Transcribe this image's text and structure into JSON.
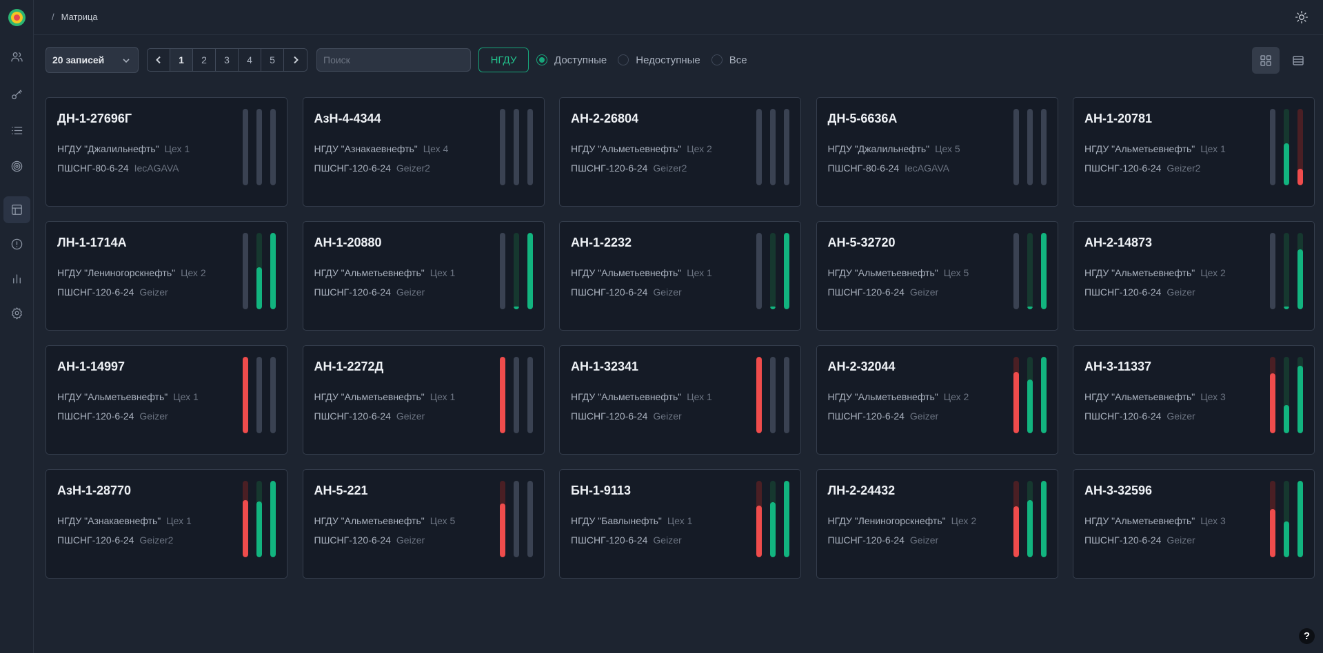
{
  "sidebar": {
    "items": [
      {
        "icon": "users-icon",
        "active": false
      },
      {
        "icon": "key-icon",
        "active": false
      },
      {
        "icon": "list-icon",
        "active": false
      },
      {
        "icon": "target-icon",
        "active": false
      },
      {
        "icon": "layout-icon",
        "active": true
      },
      {
        "icon": "alert-icon",
        "active": false
      },
      {
        "icon": "bar-chart-icon",
        "active": false
      },
      {
        "icon": "settings-icon",
        "active": false
      }
    ]
  },
  "header": {
    "breadcrumb_sep": "/",
    "breadcrumb": "Матрица"
  },
  "toolbar": {
    "page_size": "20 записей",
    "pages": [
      "1",
      "2",
      "3",
      "4",
      "5"
    ],
    "current_page": "1",
    "search_placeholder": "Поиск",
    "ngdu_label": "НГДУ",
    "filters": [
      {
        "label": "Доступные",
        "checked": true
      },
      {
        "label": "Недоступные",
        "checked": false
      },
      {
        "label": "Все",
        "checked": false
      }
    ]
  },
  "colors": {
    "accent": "#18a57a",
    "red": "#ef4c4c",
    "green": "#12b47f",
    "card_bg": "#151b26",
    "page_bg": "#1d2430"
  },
  "cards": [
    {
      "name": "ДН-1-27696Г",
      "ngdu": "НГДУ \"Джалильнефть\"",
      "shop": "Цех 1",
      "model": "ПШСНГ-80-6-24",
      "device": "IecAGAVA",
      "bars": [
        {
          "c": "grey",
          "v": 0
        },
        {
          "c": "grey",
          "v": 0
        },
        {
          "c": "grey",
          "v": 0
        }
      ]
    },
    {
      "name": "АзН-4-4344",
      "ngdu": "НГДУ \"Азнакаевнефть\"",
      "shop": "Цех 4",
      "model": "ПШСНГ-120-6-24",
      "device": "Geizer2",
      "bars": [
        {
          "c": "grey",
          "v": 0
        },
        {
          "c": "grey",
          "v": 0
        },
        {
          "c": "grey",
          "v": 0
        }
      ]
    },
    {
      "name": "АН-2-26804",
      "ngdu": "НГДУ \"Альметьевнефть\"",
      "shop": "Цех 2",
      "model": "ПШСНГ-120-6-24",
      "device": "Geizer2",
      "bars": [
        {
          "c": "grey",
          "v": 0
        },
        {
          "c": "grey",
          "v": 0
        },
        {
          "c": "grey",
          "v": 0
        }
      ]
    },
    {
      "name": "ДН-5-6636А",
      "ngdu": "НГДУ \"Джалильнефть\"",
      "shop": "Цех 5",
      "model": "ПШСНГ-80-6-24",
      "device": "IecAGAVA",
      "bars": [
        {
          "c": "grey",
          "v": 0
        },
        {
          "c": "grey",
          "v": 0
        },
        {
          "c": "grey",
          "v": 0
        }
      ]
    },
    {
      "name": "АН-1-20781",
      "ngdu": "НГДУ \"Альметьевнефть\"",
      "shop": "Цех 1",
      "model": "ПШСНГ-120-6-24",
      "device": "Geizer2",
      "bars": [
        {
          "c": "grey",
          "v": 0
        },
        {
          "c": "green",
          "v": 0.55
        },
        {
          "c": "red",
          "v": 0.22
        }
      ]
    },
    {
      "name": "ЛН-1-1714А",
      "ngdu": "НГДУ \"Лениногорскнефть\"",
      "shop": "Цех 2",
      "model": "ПШСНГ-120-6-24",
      "device": "Geizer",
      "bars": [
        {
          "c": "grey",
          "v": 0
        },
        {
          "c": "green",
          "v": 0.55
        },
        {
          "c": "green",
          "v": 1.0
        }
      ]
    },
    {
      "name": "АН-1-20880",
      "ngdu": "НГДУ \"Альметьевнефть\"",
      "shop": "Цех 1",
      "model": "ПШСНГ-120-6-24",
      "device": "Geizer",
      "bars": [
        {
          "c": "grey",
          "v": 0
        },
        {
          "c": "green",
          "v": 0.03
        },
        {
          "c": "green",
          "v": 1.0
        }
      ]
    },
    {
      "name": "АН-1-2232",
      "ngdu": "НГДУ \"Альметьевнефть\"",
      "shop": "Цех 1",
      "model": "ПШСНГ-120-6-24",
      "device": "Geizer",
      "bars": [
        {
          "c": "grey",
          "v": 0
        },
        {
          "c": "green",
          "v": 0.03
        },
        {
          "c": "green",
          "v": 1.0
        }
      ]
    },
    {
      "name": "АН-5-32720",
      "ngdu": "НГДУ \"Альметьевнефть\"",
      "shop": "Цех 5",
      "model": "ПШСНГ-120-6-24",
      "device": "Geizer",
      "bars": [
        {
          "c": "grey",
          "v": 0
        },
        {
          "c": "green",
          "v": 0.03
        },
        {
          "c": "green",
          "v": 1.0
        }
      ]
    },
    {
      "name": "АН-2-14873",
      "ngdu": "НГДУ \"Альметьевнефть\"",
      "shop": "Цех 2",
      "model": "ПШСНГ-120-6-24",
      "device": "Geizer",
      "bars": [
        {
          "c": "grey",
          "v": 0
        },
        {
          "c": "green",
          "v": 0.02
        },
        {
          "c": "green",
          "v": 0.78
        }
      ]
    },
    {
      "name": "АН-1-14997",
      "ngdu": "НГДУ \"Альметьевнефть\"",
      "shop": "Цех 1",
      "model": "ПШСНГ-120-6-24",
      "device": "Geizer",
      "bars": [
        {
          "c": "red",
          "v": 1.0
        },
        {
          "c": "grey",
          "v": 0
        },
        {
          "c": "grey",
          "v": 0
        }
      ]
    },
    {
      "name": "АН-1-2272Д",
      "ngdu": "НГДУ \"Альметьевнефть\"",
      "shop": "Цех 1",
      "model": "ПШСНГ-120-6-24",
      "device": "Geizer",
      "bars": [
        {
          "c": "red",
          "v": 1.0
        },
        {
          "c": "grey",
          "v": 0
        },
        {
          "c": "grey",
          "v": 0
        }
      ]
    },
    {
      "name": "АН-1-32341",
      "ngdu": "НГДУ \"Альметьевнефть\"",
      "shop": "Цех 1",
      "model": "ПШСНГ-120-6-24",
      "device": "Geizer",
      "bars": [
        {
          "c": "red",
          "v": 1.0
        },
        {
          "c": "grey",
          "v": 0
        },
        {
          "c": "grey",
          "v": 0
        }
      ]
    },
    {
      "name": "АН-2-32044",
      "ngdu": "НГДУ \"Альметьевнефть\"",
      "shop": "Цех 2",
      "model": "ПШСНГ-120-6-24",
      "device": "Geizer",
      "bars": [
        {
          "c": "red",
          "v": 0.8
        },
        {
          "c": "green",
          "v": 0.7
        },
        {
          "c": "green",
          "v": 1.0
        }
      ]
    },
    {
      "name": "АН-3-11337",
      "ngdu": "НГДУ \"Альметьевнефть\"",
      "shop": "Цех 3",
      "model": "ПШСНГ-120-6-24",
      "device": "Geizer",
      "bars": [
        {
          "c": "red",
          "v": 0.78
        },
        {
          "c": "green",
          "v": 0.37
        },
        {
          "c": "green",
          "v": 0.88
        }
      ]
    },
    {
      "name": "АзН-1-28770",
      "ngdu": "НГДУ \"Азнакаевнефть\"",
      "shop": "Цех 1",
      "model": "ПШСНГ-120-6-24",
      "device": "Geizer2",
      "bars": [
        {
          "c": "red",
          "v": 0.75
        },
        {
          "c": "green",
          "v": 0.73
        },
        {
          "c": "green",
          "v": 1.0
        }
      ]
    },
    {
      "name": "АН-5-221",
      "ngdu": "НГДУ \"Альметьевнефть\"",
      "shop": "Цех 5",
      "model": "ПШСНГ-120-6-24",
      "device": "Geizer",
      "bars": [
        {
          "c": "red",
          "v": 0.7
        },
        {
          "c": "grey",
          "v": 0
        },
        {
          "c": "grey",
          "v": 0
        }
      ]
    },
    {
      "name": "БН-1-9113",
      "ngdu": "НГДУ \"Бавлынефть\"",
      "shop": "Цех 1",
      "model": "ПШСНГ-120-6-24",
      "device": "Geizer",
      "bars": [
        {
          "c": "red",
          "v": 0.68
        },
        {
          "c": "green",
          "v": 0.72
        },
        {
          "c": "green",
          "v": 1.0
        }
      ]
    },
    {
      "name": "ЛН-2-24432",
      "ngdu": "НГДУ \"Лениногорскнефть\"",
      "shop": "Цех 2",
      "model": "ПШСНГ-120-6-24",
      "device": "Geizer",
      "bars": [
        {
          "c": "red",
          "v": 0.67
        },
        {
          "c": "green",
          "v": 0.75
        },
        {
          "c": "green",
          "v": 1.0
        }
      ]
    },
    {
      "name": "АН-3-32596",
      "ngdu": "НГДУ \"Альметьевнефть\"",
      "shop": "Цех 3",
      "model": "ПШСНГ-120-6-24",
      "device": "Geizer",
      "bars": [
        {
          "c": "red",
          "v": 0.63
        },
        {
          "c": "green",
          "v": 0.47
        },
        {
          "c": "green",
          "v": 1.0
        }
      ]
    }
  ],
  "help": {
    "label": "?"
  }
}
